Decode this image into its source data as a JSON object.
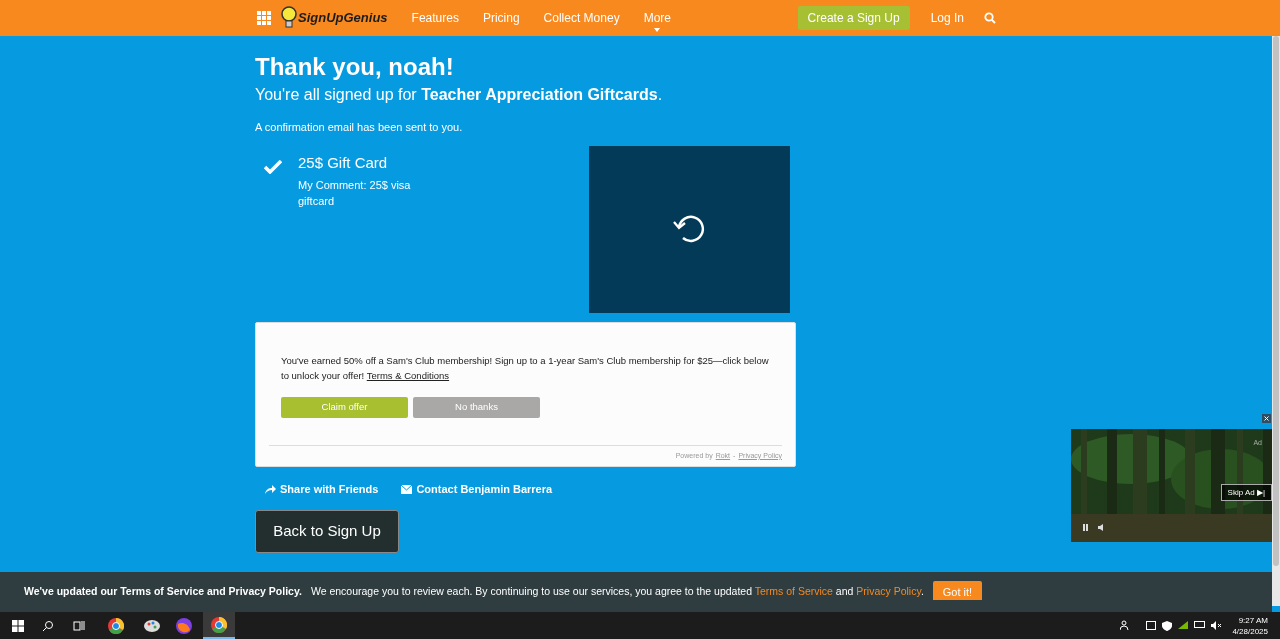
{
  "header": {
    "logo": "SignUpGenius",
    "nav": [
      "Features",
      "Pricing",
      "Collect Money",
      "More"
    ],
    "create_button": "Create a Sign Up",
    "login": "Log In"
  },
  "confirmation": {
    "title": "Thank you, noah!",
    "subtitle": "You're all signed up for **Teacher Appreciation Giftcards**.",
    "email_note": "A confirmation email has been sent to you."
  },
  "items": [
    {
      "name": "25$ Gift Card",
      "comment": "My Comment: 25$ visa giftcard",
      "checked": true
    }
  ],
  "offer": {
    "text": "You've earned 50% off a Sam's Club membership! Sign up to a 1-year Sam's Club membership for $25—click below to unlock your offer!",
    "terms_link": "Terms & Conditions",
    "claim_button": "Claim offer",
    "decline_button": "No thanks",
    "powered_by": "Powered by",
    "rokt_link": "Rokt",
    "separator": "-",
    "privacy_link": "Privacy Policy"
  },
  "actions": [
    {
      "kind": "share",
      "label": "Share with Friends"
    },
    {
      "kind": "contact",
      "label": "Contact Benjamin Barrera"
    }
  ],
  "back_button": "Back to Sign Up",
  "video_ad": {
    "ad_label": "Ad",
    "skip_button": "Skip Ad ▶|"
  },
  "cookie_banner": {
    "heading": "We've updated our Terms of Service and Privacy Policy.",
    "text_before": "We encourage you to review each. By continuing to use our services, you agree to the updated",
    "terms_link": "Terms of Service",
    "and": "and",
    "privacy_link": "Privacy Policy",
    "period": ".",
    "button": "Got it!"
  },
  "taskbar": {
    "time": "9:27 AM",
    "date": "4/28/2025"
  }
}
